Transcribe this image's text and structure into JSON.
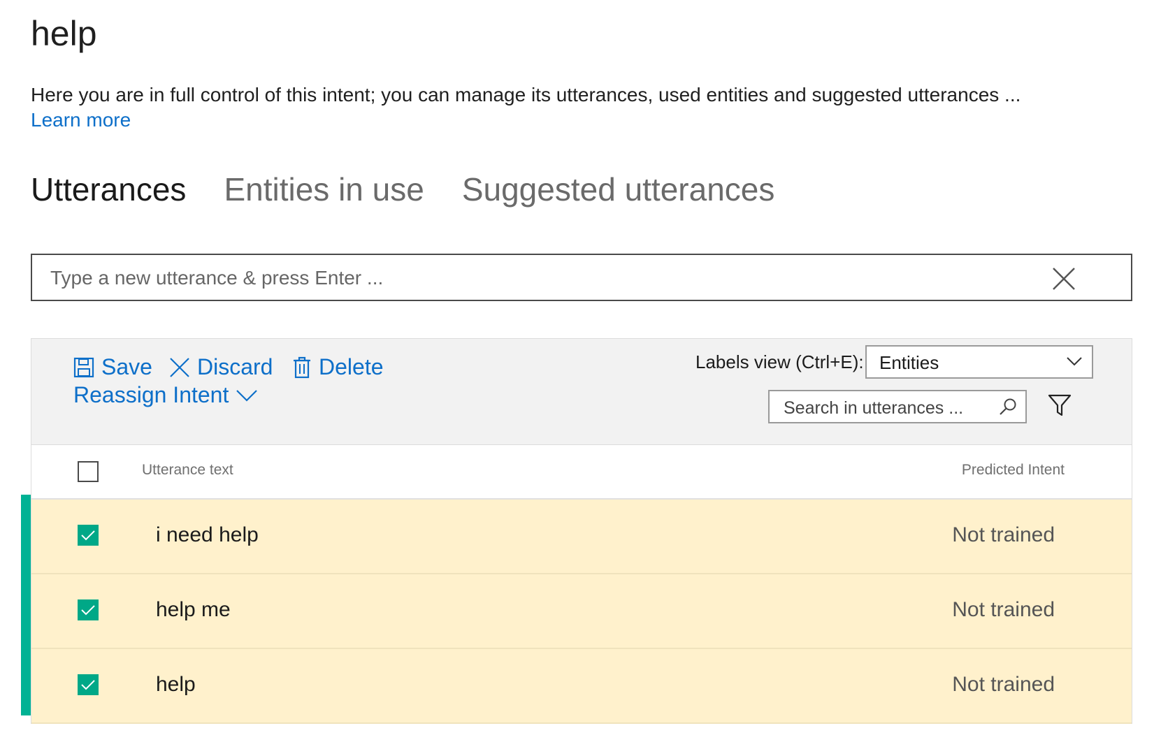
{
  "page": {
    "title": "help",
    "description": "Here you are in full control of this intent; you can manage its utterances, used entities and suggested utterances ...",
    "learn_more": "Learn more"
  },
  "tabs": [
    {
      "label": "Utterances",
      "active": true
    },
    {
      "label": "Entities in use",
      "active": false
    },
    {
      "label": "Suggested utterances",
      "active": false
    }
  ],
  "utterance_input": {
    "placeholder": "Type a new utterance & press Enter ...",
    "value": ""
  },
  "toolbar": {
    "save_label": "Save",
    "discard_label": "Discard",
    "delete_label": "Delete",
    "reassign_label": "Reassign Intent",
    "labels_view_label": "Labels view (Ctrl+E):",
    "labels_view_value": "Entities",
    "search_placeholder": "Search in utterances ..."
  },
  "table": {
    "headers": {
      "utterance": "Utterance text",
      "intent": "Predicted Intent"
    },
    "rows": [
      {
        "text": "i need help",
        "intent": "Not trained",
        "checked": true
      },
      {
        "text": "help me",
        "intent": "Not trained",
        "checked": true
      },
      {
        "text": "help",
        "intent": "Not trained",
        "checked": true
      }
    ]
  },
  "colors": {
    "accent": "#0d6fc9",
    "selected_row": "#fff1cc",
    "check_green": "#00a887",
    "selection_bar": "#00b294"
  },
  "icons": [
    "close-icon",
    "save-icon",
    "discard-icon",
    "delete-icon",
    "chevron-down-icon",
    "search-icon",
    "filter-icon",
    "checkmark-icon"
  ]
}
